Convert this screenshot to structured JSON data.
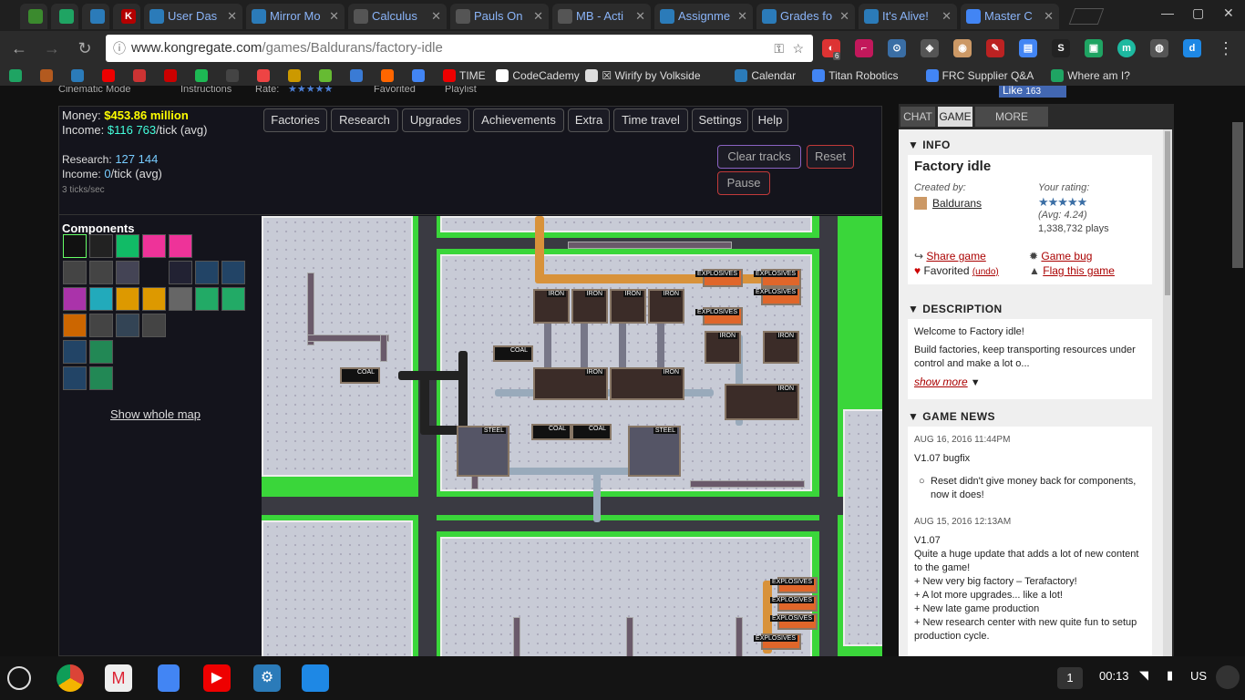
{
  "tabs": [
    {
      "label": "",
      "color": "#3b8a2e",
      "icon": "evernote-icon"
    },
    {
      "label": "",
      "color": "#1fa463",
      "icon": "drive-icon"
    },
    {
      "label": "",
      "color": "#2b7bb9",
      "icon": "gear-icon"
    },
    {
      "label": "",
      "color": "#b40000",
      "icon": "kongregate-icon",
      "letter": "K"
    },
    {
      "label": "User Das",
      "color": "#2b7bb9",
      "icon": "gear-icon"
    },
    {
      "label": "Mirror Mo",
      "color": "#2b7bb9",
      "icon": "gear-icon"
    },
    {
      "label": "Calculus",
      "color": "#555",
      "icon": "puzzle-icon"
    },
    {
      "label": "Pauls On",
      "color": "#555",
      "icon": "document-icon"
    },
    {
      "label": "MB - Acti",
      "color": "#555",
      "icon": "document-icon"
    },
    {
      "label": "Assignme",
      "color": "#2b7bb9",
      "icon": "gear-icon"
    },
    {
      "label": "Grades fo",
      "color": "#2b7bb9",
      "icon": "gear-icon"
    },
    {
      "label": "It's Alive!",
      "color": "#2b7bb9",
      "icon": "gear-icon"
    },
    {
      "label": "Master C",
      "color": "#4285f4",
      "icon": "docs-icon"
    }
  ],
  "address": {
    "url": "www.kongregate.com/games/Balduran/factory-idle",
    "url_host": "www.kongregate.com",
    "url_path": "/games/Baldurans/factory-idle"
  },
  "extensions": {
    "badge": "6"
  },
  "bookmarks": [
    {
      "label": "",
      "color": "#1fa463"
    },
    {
      "label": "",
      "color": "#b35a1f"
    },
    {
      "label": "",
      "color": "#2b7bb9"
    },
    {
      "label": "",
      "color": "#e00"
    },
    {
      "label": "",
      "color": "#c33"
    },
    {
      "label": "",
      "color": "#c00"
    },
    {
      "label": "",
      "color": "#1db954"
    },
    {
      "label": "",
      "color": "#444"
    },
    {
      "label": "",
      "color": "#e44"
    },
    {
      "label": "",
      "color": "#c90"
    },
    {
      "label": "",
      "color": "#6b3"
    },
    {
      "label": "",
      "color": "#3a7bd5"
    },
    {
      "label": "",
      "color": "#f60"
    },
    {
      "label": "",
      "color": "#4285f4"
    },
    {
      "label": "TIME",
      "color": "#e00"
    },
    {
      "label": "CodeCademy",
      "color": "#fff"
    },
    {
      "label": "☒ Wirify by Volkside",
      "color": "#ddd"
    },
    {
      "label": "Calendar",
      "color": "#2b7bb9"
    },
    {
      "label": "Titan Robotics",
      "color": "#4285f4"
    },
    {
      "label": "FRC Supplier Q&A",
      "color": "#4285f4"
    },
    {
      "label": "Where am I?",
      "color": "#1fa463"
    }
  ],
  "subnav": {
    "cinematic": "Cinematic Mode",
    "instructions": "Instructions",
    "rate": "Rate:",
    "favorited": "Favorited",
    "playlist": "Playlist",
    "like": "Like",
    "like_count": "163"
  },
  "game": {
    "money_label": "Money:",
    "money": "$453.86 million",
    "income_label": "Income:",
    "income": "$116 763",
    "income_unit": "/tick (avg)",
    "research_label": "Research:",
    "research": "127 144",
    "research_income_label": "Income:",
    "research_income": "0",
    "research_income_unit": "/tick (avg)",
    "ticks": "3 ticks/sec",
    "menu": [
      "Factories",
      "Research",
      "Upgrades",
      "Achievements",
      "Extra",
      "Time travel",
      "Settings",
      "Help"
    ],
    "clear_tracks": "Clear tracks",
    "reset": "Reset",
    "pause": "Pause",
    "components_title": "Components",
    "show_map": "Show whole map",
    "labels": {
      "iron": "IRON",
      "coal": "COAL",
      "steel": "STEEL",
      "explosives": "EXPLOSIVES"
    }
  },
  "sidebar": {
    "tabs": [
      "CHAT",
      "GAME",
      "MORE GAMES"
    ],
    "info_header": "INFO",
    "title": "Factory idle",
    "created_by_label": "Created by:",
    "author": "Baldurans",
    "your_rating_label": "Your rating:",
    "avg": "(Avg: 4.24)",
    "plays": "1,338,732 plays",
    "share": "Share game",
    "game_bug": "Game bug",
    "favorited": "Favorited",
    "undo": "(undo)",
    "flag": "Flag this game",
    "desc_header": "DESCRIPTION",
    "desc_1": "Welcome to Factory idle!",
    "desc_2": "Build factories, keep transporting resources under control and make a lot o...",
    "show_more": "show more",
    "news_header": "GAME NEWS",
    "news": [
      {
        "date": "AUG 16, 2016 11:44PM",
        "title": "V1.07 bugfix",
        "bullet": "Reset didn't give money back for components, now it does!"
      },
      {
        "date": "AUG 15, 2016 12:13AM",
        "title": "V1.07",
        "lines": [
          "Quite a huge update that adds a lot of new content to the game!",
          "+ New very big factory – Terafactory!",
          "+ A lot more upgrades... like a lot!",
          "+ New late game production",
          "+ New research center with new quite fun to setup production cycle."
        ]
      }
    ]
  },
  "taskbar": {
    "badge": "1",
    "time": "00:13",
    "lang": "US"
  }
}
